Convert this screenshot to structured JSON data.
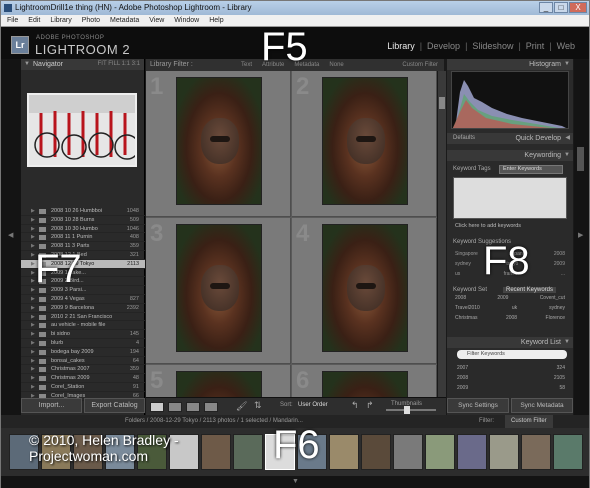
{
  "window": {
    "title": "LightroomDrill1e thing (HN) - Adobe Photoshop Lightroom - Library",
    "buttons": [
      "_",
      "□",
      "X"
    ]
  },
  "menu": [
    "File",
    "Edit",
    "Library",
    "Photo",
    "Metadata",
    "View",
    "Window",
    "Help"
  ],
  "identity": {
    "badge": "Lr",
    "brand_small": "ADOBE PHOTOSHOP",
    "brand_big": "LIGHTROOM 2"
  },
  "modules": [
    "Library",
    "Develop",
    "Slideshow",
    "Print",
    "Web"
  ],
  "overlay_keys": {
    "f5": "F5",
    "f6": "F6",
    "f7": "F7",
    "f8": "F8"
  },
  "left_panel": {
    "navigator": "Navigator",
    "navigator_opts": "FIT  FILL  1:1  3:1",
    "folders": [
      {
        "name": "2008 10 26 Humbboi",
        "count": "1048",
        "selected": false
      },
      {
        "name": "2008 10 28 Burns",
        "count": "509",
        "selected": false
      },
      {
        "name": "2008 10 30 Humbo",
        "count": "1046",
        "selected": false
      },
      {
        "name": "2008 11 1 Purnin",
        "count": "408",
        "selected": false
      },
      {
        "name": "2008 11 3 Parts",
        "count": "359",
        "selected": false
      },
      {
        "name": "2008 12 1 Bed",
        "count": "321",
        "selected": false
      },
      {
        "name": "2008 12 29 Tokyo",
        "count": "2113",
        "selected": true
      },
      {
        "name": "2009 1 Lake...",
        "count": "",
        "selected": false
      },
      {
        "name": "2009 2 Bird...",
        "count": "",
        "selected": false
      },
      {
        "name": "2009 3 Parsi...",
        "count": "",
        "selected": false
      },
      {
        "name": "2009 4 Vegas",
        "count": "827",
        "selected": false
      },
      {
        "name": "2009 9 Barcelona",
        "count": "2392",
        "selected": false
      },
      {
        "name": "2010 2 21 San Francisco",
        "count": "",
        "selected": false
      },
      {
        "name": "au vehicle - mobile file",
        "count": "",
        "selected": false
      },
      {
        "name": "bi sidno",
        "count": "145",
        "selected": false
      },
      {
        "name": "blurb",
        "count": "4",
        "selected": false
      },
      {
        "name": "bodega bay 2009",
        "count": "194",
        "selected": false
      },
      {
        "name": "bonsai_cakes",
        "count": "64",
        "selected": false
      },
      {
        "name": "Christmas 2007",
        "count": "359",
        "selected": false
      },
      {
        "name": "Christmas 2009",
        "count": "48",
        "selected": false
      },
      {
        "name": "Corel_Station",
        "count": "91",
        "selected": false
      },
      {
        "name": "Corel_Images",
        "count": "66",
        "selected": false
      }
    ],
    "import": "Import...",
    "export": "Export Catalog"
  },
  "filter_bar": {
    "label": "Library Filter :",
    "items": [
      "Text",
      "Attribute",
      "Metadata",
      "None"
    ],
    "custom": "Custom Filter"
  },
  "grid": {
    "cells": [
      "1",
      "2",
      "3",
      "4",
      "5",
      "6"
    ]
  },
  "toolbar": {
    "sort_label": "Sort:",
    "sort_value": "User Order",
    "thumbs_label": "Thumbnails"
  },
  "right_panel": {
    "histogram": "Histogram",
    "quick_develop": "Quick Develop",
    "defaults": "Defaults",
    "keywording": "Keywording",
    "keyword_tags_label": "Keyword Tags",
    "keyword_tags_value": "Enter Keywords",
    "keyword_hint": "Click here to add keywords",
    "suggestions_label": "Keyword Suggestions",
    "suggestions": [
      [
        "Singapore",
        "Japan",
        "2008"
      ],
      [
        "sydney",
        "tokyo",
        "2009"
      ],
      [
        "us",
        "france",
        "..."
      ]
    ],
    "keyword_set_label": "Keyword Set",
    "keyword_set_value": "Recent Keywords",
    "keyword_set": [
      [
        "2008",
        "2009",
        "Covent_cut"
      ],
      [
        "Travel2010",
        "uk",
        "sydney"
      ],
      [
        "Christmas",
        "2008",
        "Florence"
      ]
    ],
    "keyword_list": "Keyword List",
    "filter_keywords": "Filter Keywords",
    "keyword_list_rows": [
      [
        "2007",
        "324"
      ],
      [
        "2008",
        "2105"
      ],
      [
        "2009",
        "58"
      ]
    ],
    "sync_settings": "Sync Settings",
    "sync_metadata": "Sync Metadata"
  },
  "filmstrip_header": {
    "path": "Folders / 2008-12-29 Tokyo / 2113 photos / 1 selected / Mandarin...",
    "filter_label": "Filter:",
    "filter_value": "Custom Filter"
  },
  "copyright": {
    "line1": "© 2010, Helen Bradley -",
    "line2": "Projectwoman.com"
  }
}
